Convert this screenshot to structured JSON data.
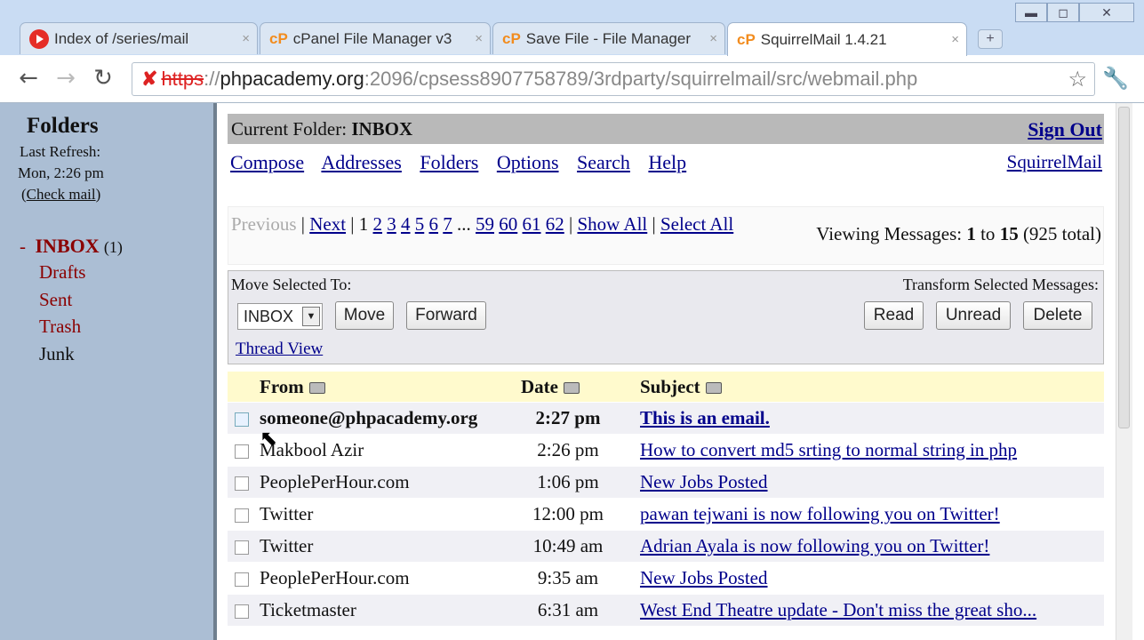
{
  "browser": {
    "tabs": [
      {
        "title": "Index of /series/mail",
        "icon": "youtube-icon",
        "active": false
      },
      {
        "title": "cPanel File Manager v3",
        "icon": "cpanel-icon",
        "active": false
      },
      {
        "title": "Save File - File Manager",
        "icon": "cpanel-icon",
        "active": false
      },
      {
        "title": "SquirrelMail 1.4.21",
        "icon": "cpanel-icon",
        "active": true
      }
    ],
    "tab_icon_text": "cP",
    "tab_close": "×",
    "new_tab": "+",
    "window_buttons": {
      "minimize": "▬",
      "maximize": "◻",
      "close": "✕"
    },
    "nav": {
      "back": "←",
      "forward": "→",
      "reload": "↻"
    },
    "url": {
      "scheme": "https",
      "separator": "://",
      "host": "phpacademy.org",
      "path": ":2096/cpsess8907758789/3rdparty/squirrelmail/src/webmail.php"
    },
    "star": "☆",
    "wrench": "🔧"
  },
  "left": {
    "title": "Folders",
    "last_refresh_label": "Last Refresh:",
    "last_refresh_time": "Mon, 2:26 pm",
    "check_mail": "Check mail",
    "inbox_marker": "-",
    "inbox": "INBOX",
    "inbox_count": "(1)",
    "folders": [
      {
        "name": "Drafts",
        "link": true
      },
      {
        "name": "Sent",
        "link": true
      },
      {
        "name": "Trash",
        "link": true
      },
      {
        "name": "Junk",
        "link": false
      }
    ]
  },
  "main": {
    "current_folder_label": "Current Folder:",
    "current_folder": "INBOX",
    "sign_out": "Sign Out",
    "links": [
      "Compose",
      "Addresses",
      "Folders",
      "Options",
      "Search",
      "Help"
    ],
    "squirrelmail_link": "SquirrelMail",
    "pager": {
      "previous": "Previous",
      "next": "Next",
      "current": "1",
      "pages": [
        "2",
        "3",
        "4",
        "5",
        "6",
        "7"
      ],
      "ellipsis": "...",
      "last_pages": [
        "59",
        "60",
        "61",
        "62"
      ],
      "show_all": "Show All",
      "select_all": "Select All"
    },
    "viewing": {
      "prefix": "Viewing Messages:",
      "from": "1",
      "to_word": "to",
      "to": "15",
      "total": "(925 total)"
    },
    "move_label": "Move Selected To:",
    "move_folder": "INBOX",
    "move_button": "Move",
    "forward_button": "Forward",
    "transform_label": "Transform Selected Messages:",
    "read_button": "Read",
    "unread_button": "Unread",
    "delete_button": "Delete",
    "thread_view": "Thread View",
    "columns": {
      "from": "From",
      "date": "Date",
      "subject": "Subject"
    },
    "messages": [
      {
        "from": "someone@phpacademy.org",
        "date": "2:27 pm",
        "subject": "This is an email.",
        "unread": true
      },
      {
        "from": "Makbool Azir",
        "date": "2:26 pm",
        "subject": "How to convert md5 srting to normal string in php",
        "unread": false
      },
      {
        "from": "PeoplePerHour.com",
        "date": "1:06 pm",
        "subject": "New Jobs Posted",
        "unread": false
      },
      {
        "from": "Twitter",
        "date": "12:00 pm",
        "subject": "pawan tejwani is now following you on Twitter!",
        "unread": false
      },
      {
        "from": "Twitter",
        "date": "10:49 am",
        "subject": "Adrian Ayala is now following you on Twitter!",
        "unread": false
      },
      {
        "from": "PeoplePerHour.com",
        "date": "9:35 am",
        "subject": "New Jobs Posted",
        "unread": false
      },
      {
        "from": "Ticketmaster",
        "date": "6:31 am",
        "subject": "West End Theatre update - Don't miss the great sho...",
        "unread": false
      }
    ]
  }
}
